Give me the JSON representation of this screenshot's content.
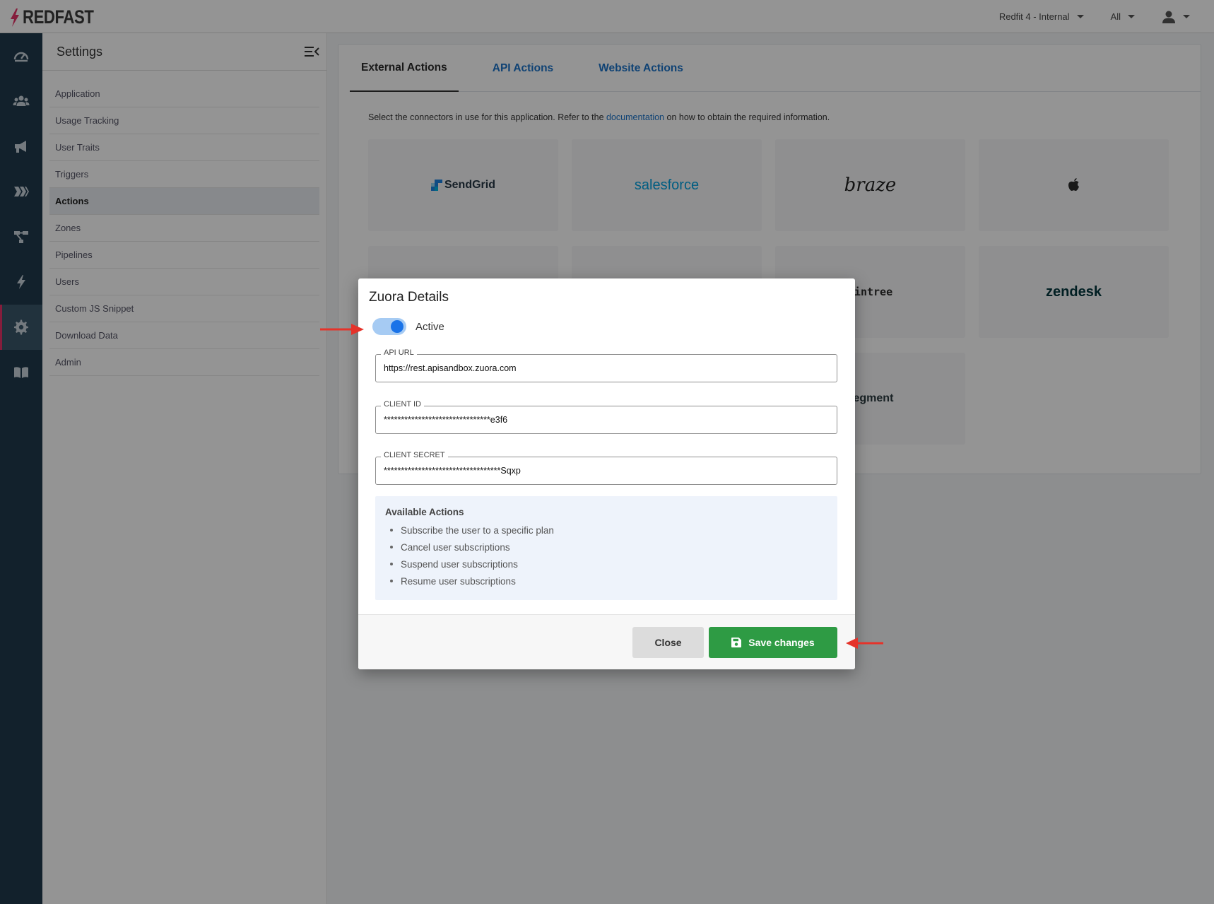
{
  "topbar": {
    "logo_text": "REDFAST",
    "app_selector": "Redfit 4 - Internal",
    "scope_selector": "All"
  },
  "rail": {
    "items": [
      "dashboard-icon",
      "users-icon",
      "megaphone-icon",
      "prompts-icon",
      "flow-icon",
      "bolt-icon",
      "gear-icon",
      "book-icon"
    ],
    "active": "gear-icon"
  },
  "settings": {
    "title": "Settings",
    "items": [
      {
        "label": "Application"
      },
      {
        "label": "Usage Tracking"
      },
      {
        "label": "User Traits"
      },
      {
        "label": "Triggers"
      },
      {
        "label": "Actions"
      },
      {
        "label": "Zones"
      },
      {
        "label": "Pipelines"
      },
      {
        "label": "Users"
      },
      {
        "label": "Custom JS Snippet"
      },
      {
        "label": "Download Data"
      },
      {
        "label": "Admin"
      }
    ],
    "active": "Actions"
  },
  "main": {
    "tabs": [
      {
        "label": "External Actions"
      },
      {
        "label": "API Actions"
      },
      {
        "label": "Website Actions"
      }
    ],
    "active_tab": "External Actions",
    "intro_before": "Select the connectors in use for this application. Refer to the ",
    "intro_link": "documentation",
    "intro_after": " on how to obtain the required information.",
    "connectors": {
      "sendgrid": "SendGrid",
      "salesforce": "salesforce",
      "braze": "braze",
      "braintree": "aintree",
      "zendesk": "zendesk",
      "segment": "segment"
    }
  },
  "modal": {
    "title": "Zuora Details",
    "toggle_label": "Active",
    "toggle_on": true,
    "fields": {
      "api_url": {
        "label": "API URL",
        "value": "https://rest.apisandbox.zuora.com"
      },
      "client_id": {
        "label": "CLIENT ID",
        "value": "*******************************e3f6"
      },
      "client_secret": {
        "label": "CLIENT SECRET",
        "value": "**********************************Sqxp"
      }
    },
    "available_actions": {
      "title": "Available Actions",
      "items": [
        "Subscribe the user to a specific plan",
        "Cancel user subscriptions",
        "Suspend user subscriptions",
        "Resume user subscriptions"
      ]
    },
    "close_label": "Close",
    "save_label": "Save changes"
  },
  "colors": {
    "brand_accent": "#e53368",
    "link": "#1a73c9",
    "save_button": "#2e9b44",
    "toggle": "#1a73e8",
    "annotation_arrow": "#e5332a"
  }
}
